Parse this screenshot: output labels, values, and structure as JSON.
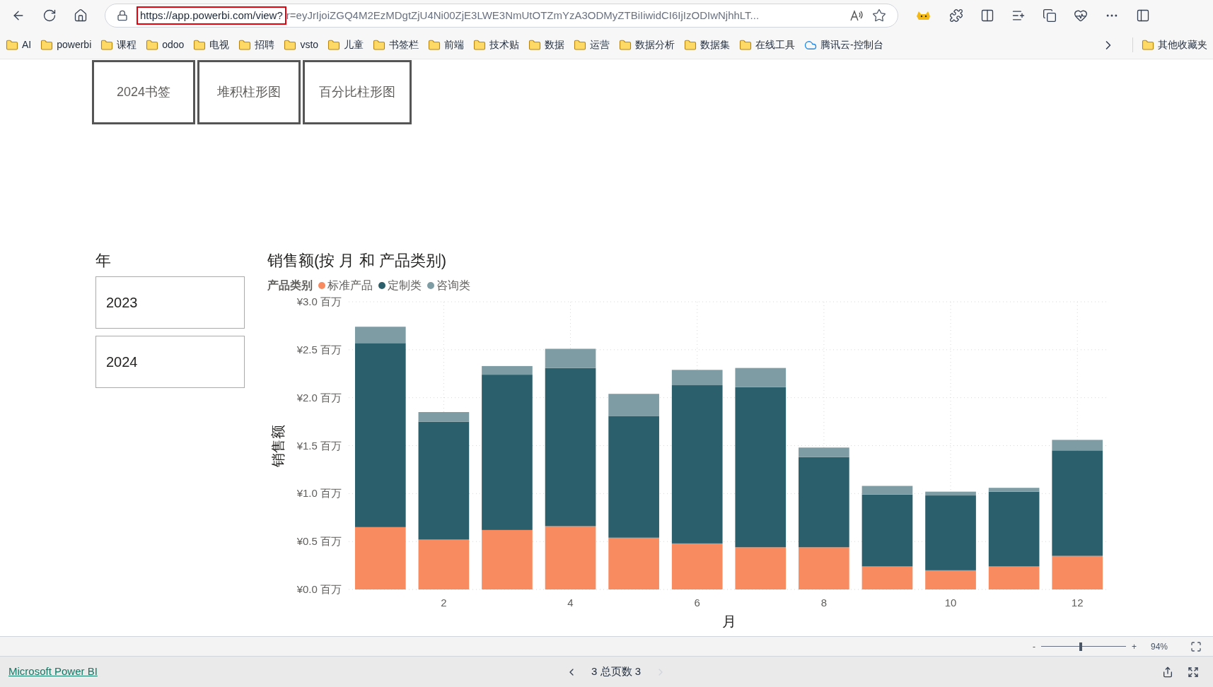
{
  "browser": {
    "url_highlighted": "https://app.powerbi.com/view?",
    "url_rest": "r=eyJrIjoiZGQ4M2EzMDgtZjU4Ni00ZjE3LWE3NmUtOTZmYzA3ODMyZTBiIiwidCI6IjIzODIwNjhhLT...",
    "bookmarks": [
      {
        "label": "AI",
        "kind": "folder"
      },
      {
        "label": "powerbi",
        "kind": "folder"
      },
      {
        "label": "课程",
        "kind": "folder"
      },
      {
        "label": "odoo",
        "kind": "folder"
      },
      {
        "label": "电视",
        "kind": "folder"
      },
      {
        "label": "招聘",
        "kind": "folder"
      },
      {
        "label": "vsto",
        "kind": "folder"
      },
      {
        "label": "儿童",
        "kind": "folder"
      },
      {
        "label": "书签栏",
        "kind": "folder"
      },
      {
        "label": "前端",
        "kind": "folder"
      },
      {
        "label": "技术贴",
        "kind": "folder"
      },
      {
        "label": "数据",
        "kind": "folder"
      },
      {
        "label": "运营",
        "kind": "folder"
      },
      {
        "label": "数据分析",
        "kind": "folder"
      },
      {
        "label": "数据集",
        "kind": "folder"
      },
      {
        "label": "在线工具",
        "kind": "folder"
      },
      {
        "label": "腾讯云-控制台",
        "kind": "cloud"
      }
    ],
    "other_bookmarks": "其他收藏夹"
  },
  "report": {
    "bookmark_buttons": [
      "2024书签",
      "堆积柱形图",
      "百分比柱形图"
    ],
    "slicer": {
      "title": "年",
      "items": [
        "2023",
        "2024"
      ]
    },
    "chart": {
      "title": "销售额(按 月 和 产品类别)",
      "legend_title": "产品类别",
      "chart_data": {
        "type": "bar",
        "stacked": true,
        "xlabel": "月",
        "ylabel": "销售额",
        "x": [
          1,
          2,
          3,
          4,
          5,
          6,
          7,
          8,
          9,
          10,
          11,
          12
        ],
        "xticks": [
          2,
          4,
          6,
          8,
          10,
          12
        ],
        "xlim": [
          0.5,
          12.5
        ],
        "grid": true,
        "ylim": [
          0,
          3
        ],
        "yticks": [
          {
            "value": 0,
            "label": "¥0.0 百万"
          },
          {
            "value": 0.5,
            "label": "¥0.5 百万"
          },
          {
            "value": 1,
            "label": "¥1.0 百万"
          },
          {
            "value": 1.5,
            "label": "¥1.5 百万"
          },
          {
            "value": 2,
            "label": "¥2.0 百万"
          },
          {
            "value": 2.5,
            "label": "¥2.5 百万"
          },
          {
            "value": 3,
            "label": "¥3.0 百万"
          }
        ],
        "series": [
          {
            "name": "标准产品",
            "color": "#f98b60",
            "values": [
              0.65,
              0.52,
              0.62,
              0.66,
              0.54,
              0.48,
              0.44,
              0.44,
              0.24,
              0.2,
              0.24,
              0.35
            ]
          },
          {
            "name": "定制类",
            "color": "#2b5f6b",
            "values": [
              1.92,
              1.23,
              1.62,
              1.65,
              1.27,
              1.65,
              1.67,
              0.94,
              0.75,
              0.78,
              0.78,
              1.1
            ]
          },
          {
            "name": "咨询类",
            "color": "#7e9ca4",
            "values": [
              0.17,
              0.1,
              0.09,
              0.2,
              0.23,
              0.16,
              0.2,
              0.1,
              0.09,
              0.04,
              0.04,
              0.11
            ]
          }
        ]
      }
    }
  },
  "zoom": {
    "minus": "-",
    "plus": "+",
    "level": 0.45,
    "percent": "94%"
  },
  "footer": {
    "brand_link": "Microsoft Power BI",
    "page_indicator": "3 总页数 3",
    "prev_disabled": false,
    "next_disabled": true
  }
}
